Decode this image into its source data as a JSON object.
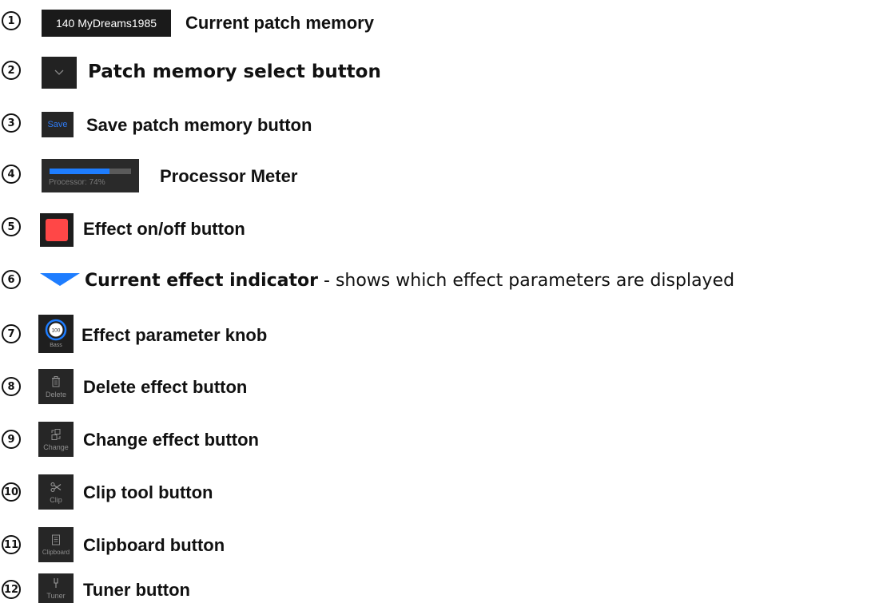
{
  "items": [
    {
      "num": "1",
      "label": "Current patch memory",
      "thumb_text": "140 MyDreams1985"
    },
    {
      "num": "2",
      "label": "Patch memory select button",
      "icon": "chevron-down-icon"
    },
    {
      "num": "3",
      "label": "Save patch memory button",
      "thumb_text": "Save"
    },
    {
      "num": "4",
      "label": "Processor Meter",
      "thumb_text": "Processor: 74%",
      "level": 0.74
    },
    {
      "num": "5",
      "label": "Effect on/off button",
      "color": "#ff4747"
    },
    {
      "num": "6",
      "label": "Current effect indicator",
      "desc": " - shows which effect parameters are displayed",
      "color": "#1e7dff"
    },
    {
      "num": "7",
      "label": "Effect parameter knob",
      "thumb_text": "100",
      "thumb_sub": "Bass"
    },
    {
      "num": "8",
      "label": "Delete effect button",
      "thumb_text": "Delete",
      "icon": "trash-icon"
    },
    {
      "num": "9",
      "label": "Change effect button",
      "thumb_text": "Change",
      "icon": "change-icon"
    },
    {
      "num": "10",
      "label": "Clip tool button",
      "thumb_text": "Clip",
      "icon": "scissors-icon"
    },
    {
      "num": "11",
      "label": "Clipboard button",
      "thumb_text": "Clipboard",
      "icon": "clipboard-icon"
    },
    {
      "num": "12",
      "label": "Tuner button",
      "thumb_text": "Tuner",
      "icon": "tuning-fork-icon"
    }
  ]
}
